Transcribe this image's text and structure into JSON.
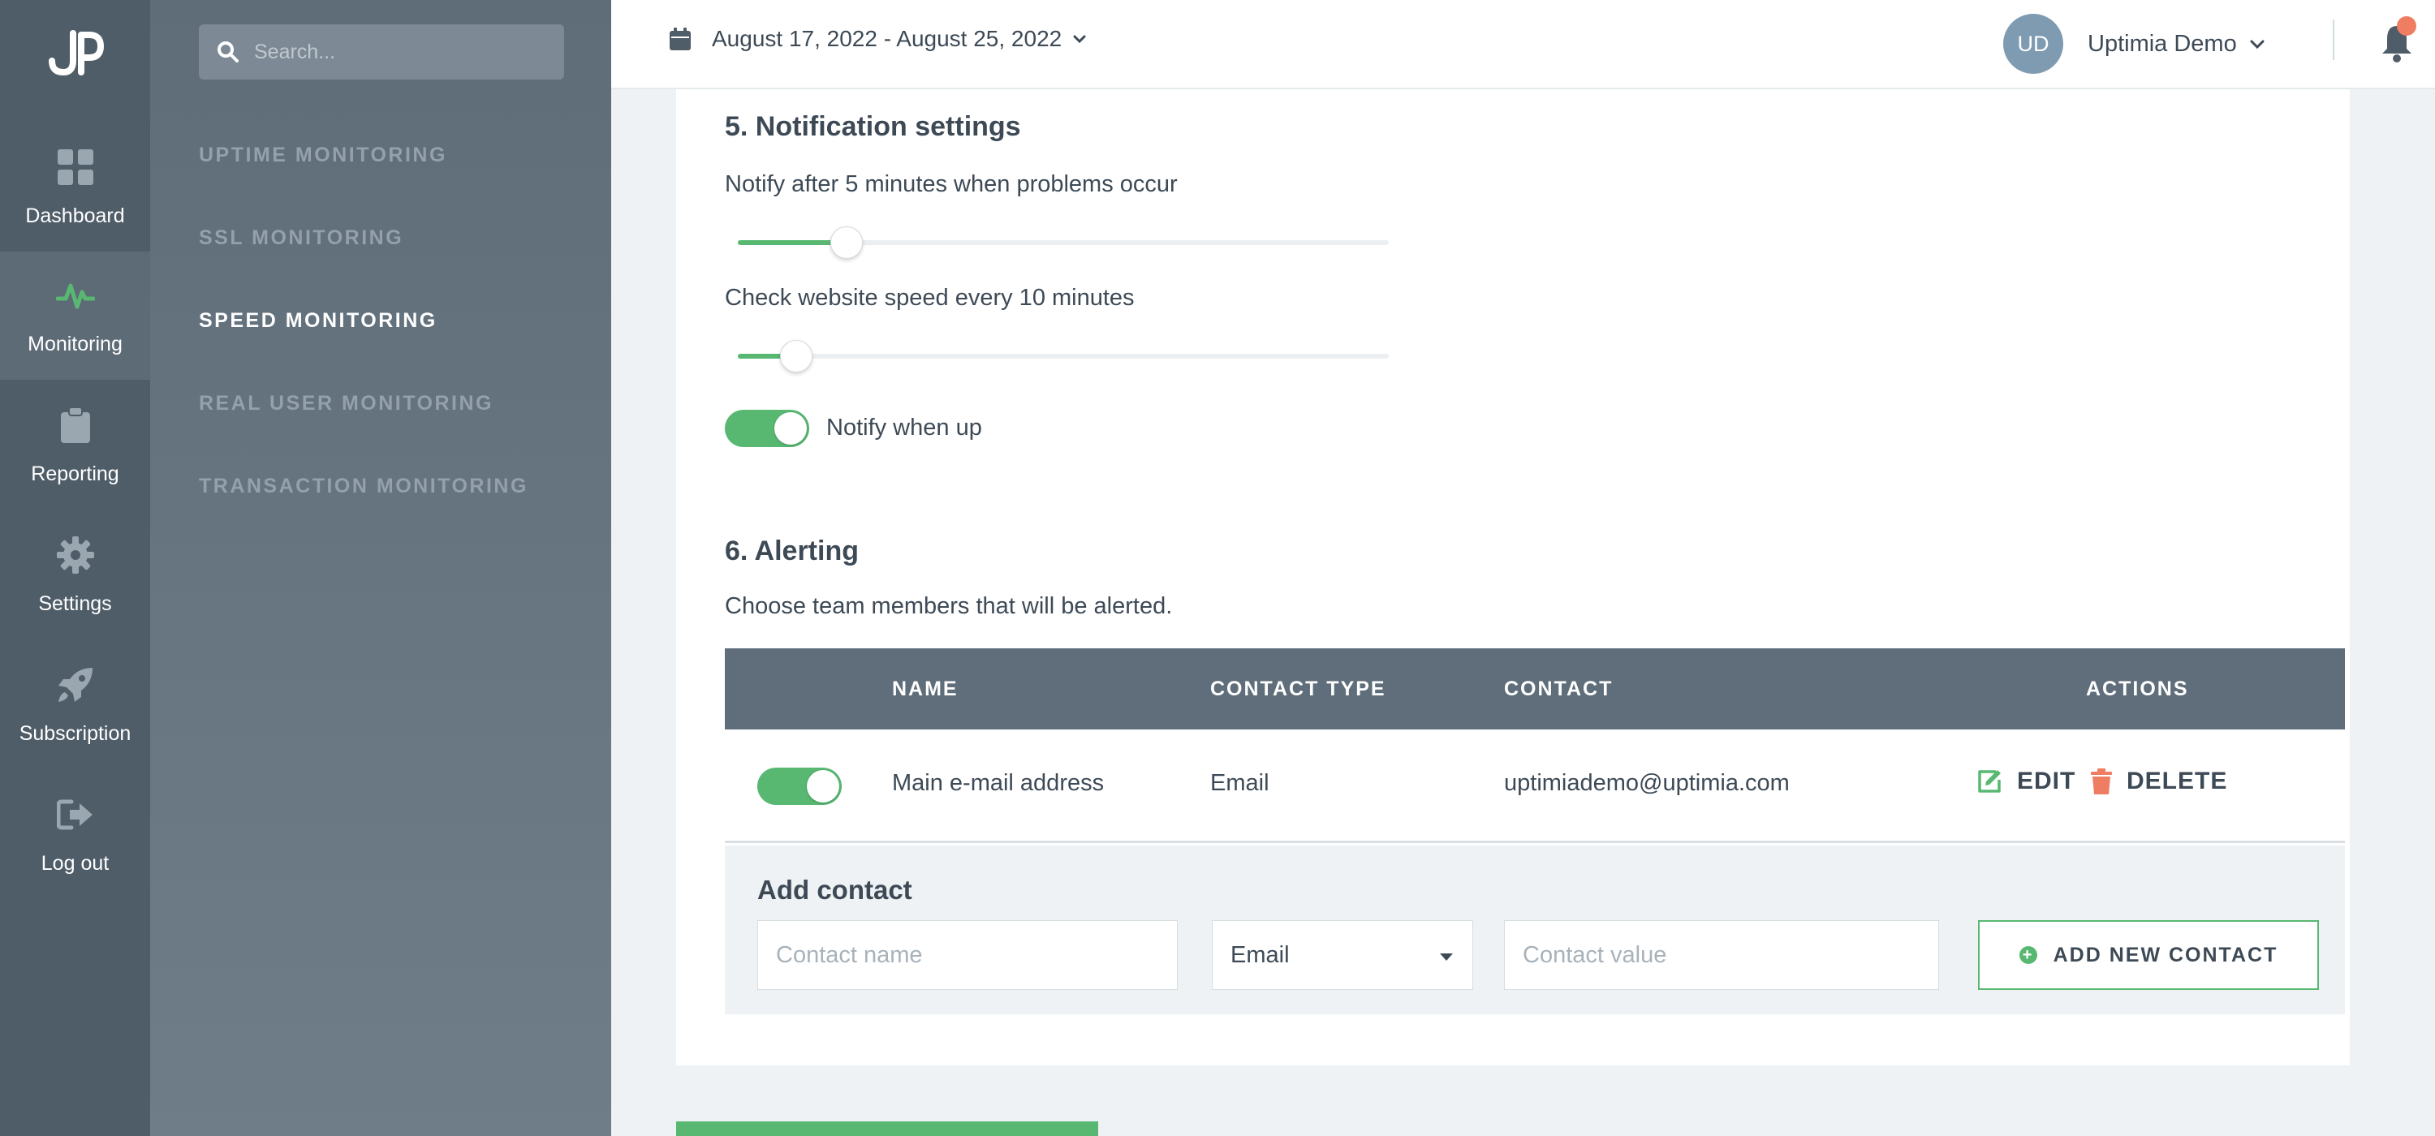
{
  "colors": {
    "accent": "#58b872",
    "danger": "#ef7d62",
    "sidebar": "#4f5d69",
    "table_header": "#5f6e7a"
  },
  "rail": {
    "logo_text": "JP",
    "items": [
      {
        "label": "Dashboard",
        "icon": "dashboard-icon"
      },
      {
        "label": "Monitoring",
        "icon": "pulse-icon",
        "active": true
      },
      {
        "label": "Reporting",
        "icon": "clipboard-icon"
      },
      {
        "label": "Settings",
        "icon": "gear-icon"
      },
      {
        "label": "Subscription",
        "icon": "rocket-icon"
      },
      {
        "label": "Log out",
        "icon": "logout-icon"
      }
    ]
  },
  "submenu": {
    "search_placeholder": "Search...",
    "items": [
      {
        "label": "UPTIME MONITORING"
      },
      {
        "label": "SSL MONITORING"
      },
      {
        "label": "SPEED MONITORING",
        "active": true
      },
      {
        "label": "REAL USER MONITORING"
      },
      {
        "label": "TRANSACTION MONITORING"
      }
    ]
  },
  "topbar": {
    "date_range": "August 17, 2022 - August 25, 2022",
    "avatar_initials": "UD",
    "user_name": "Uptimia Demo"
  },
  "notification": {
    "title": "5. Notification settings",
    "notify_after_label": "Notify after 5 minutes when problems occur",
    "notify_after_level": 0.167,
    "check_speed_label": "Check website speed every 10 minutes",
    "check_speed_level": 0.09,
    "notify_up_label": "Notify when up",
    "notify_up_on": true
  },
  "alerting": {
    "title": "6. Alerting",
    "description": "Choose team members that will be alerted.",
    "columns": {
      "name": "NAME",
      "contact_type": "CONTACT TYPE",
      "contact": "CONTACT",
      "actions": "ACTIONS"
    },
    "rows": [
      {
        "enabled": true,
        "name": "Main e-mail address",
        "contact_type": "Email",
        "contact": "uptimiademo@uptimia.com",
        "edit": "EDIT",
        "delete": "DELETE"
      }
    ],
    "add_contact": {
      "title": "Add contact",
      "name_placeholder": "Contact name",
      "type_value": "Email",
      "value_placeholder": "Contact value",
      "button_label": "ADD NEW CONTACT"
    }
  }
}
